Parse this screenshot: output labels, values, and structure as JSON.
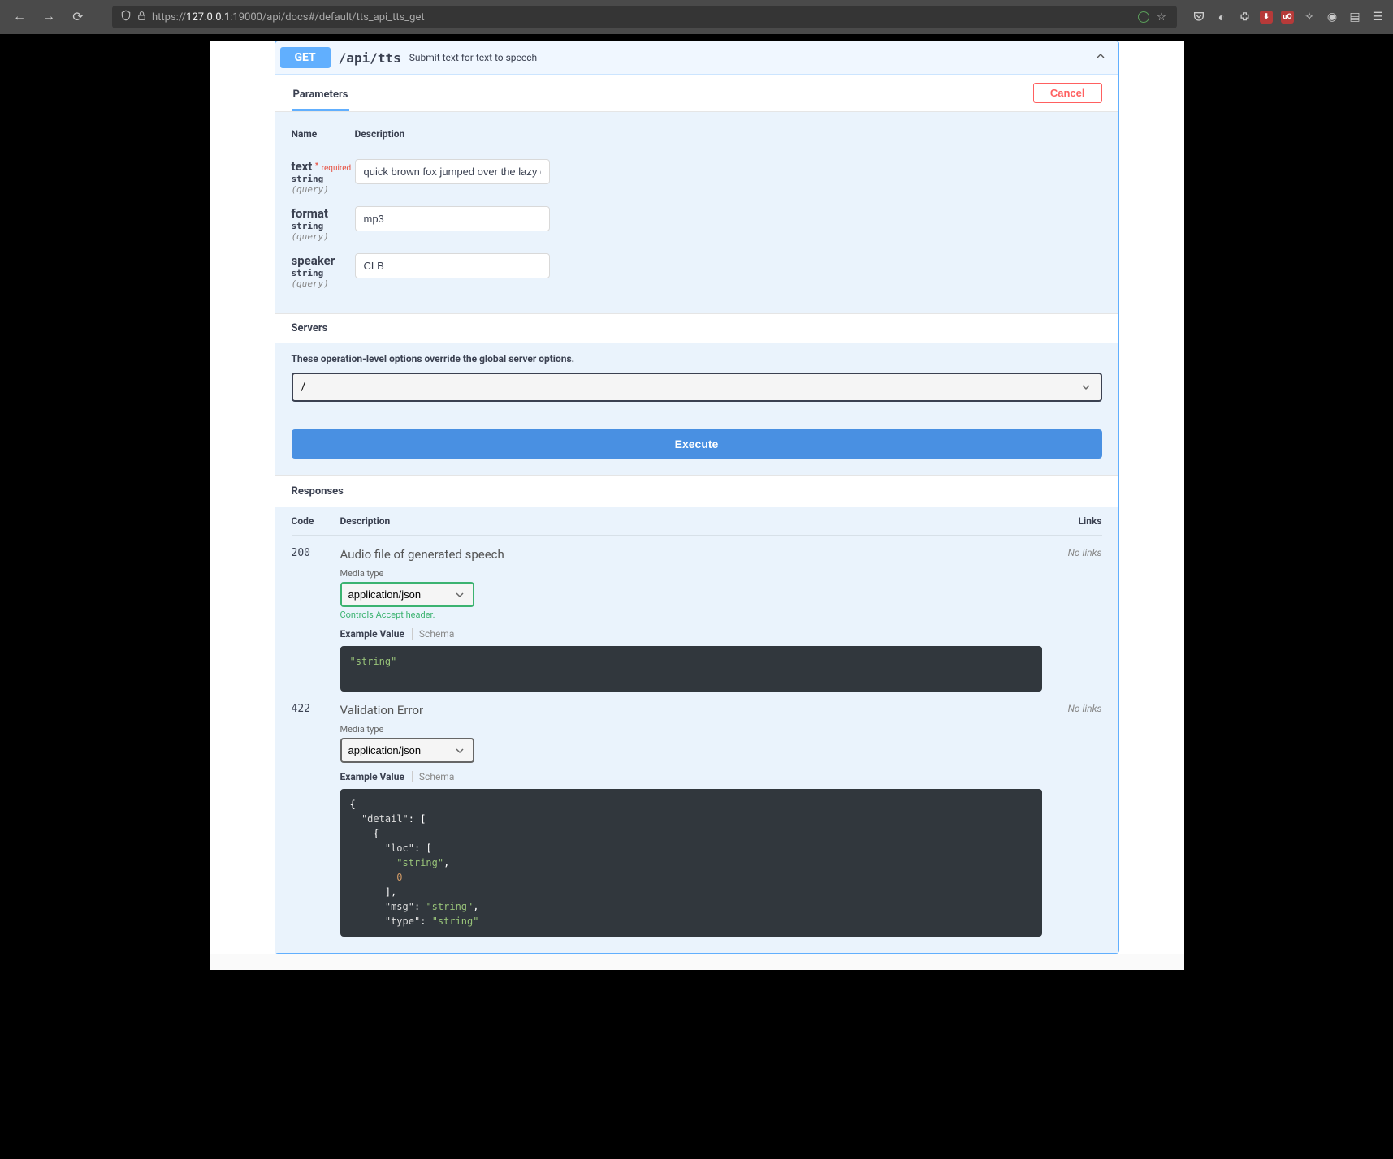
{
  "browser": {
    "url_prefix": "https://",
    "url_host_bold": "127.0.0.1",
    "url_rest": ":19000/api/docs#/default/tts_api_tts_get"
  },
  "endpoint": {
    "method": "GET",
    "path": "/api/tts",
    "summary": "Submit text for text to speech"
  },
  "parameters": {
    "section_label": "Parameters",
    "cancel_label": "Cancel",
    "head_name": "Name",
    "head_desc": "Description",
    "required_label": "required",
    "type_label": "string",
    "in_label": "(query)",
    "items": [
      {
        "name": "text",
        "required": true,
        "value": "quick brown fox jumped over the lazy dog"
      },
      {
        "name": "format",
        "required": false,
        "value": "mp3"
      },
      {
        "name": "speaker",
        "required": false,
        "value": "CLB"
      }
    ]
  },
  "servers": {
    "section_label": "Servers",
    "note": "These operation-level options override the global server options.",
    "selected": "/"
  },
  "execute_label": "Execute",
  "responses": {
    "section_label": "Responses",
    "head_code": "Code",
    "head_desc": "Description",
    "head_links": "Links",
    "media_label": "Media type",
    "accept_note": "Controls Accept header.",
    "example_tab": "Example Value",
    "schema_tab": "Schema",
    "no_links": "No links",
    "items": [
      {
        "code": "200",
        "title": "Audio file of generated speech",
        "media": "application/json",
        "accept_note_shown": true,
        "body_html": "<span class='tok-str'>\"string\"</span>"
      },
      {
        "code": "422",
        "title": "Validation Error",
        "media": "application/json",
        "accept_note_shown": false,
        "body_html": "<span class='tok-punc'>{</span>\n  <span class='tok-key'>\"detail\"</span><span class='tok-punc'>: [</span>\n    <span class='tok-punc'>{</span>\n      <span class='tok-key'>\"loc\"</span><span class='tok-punc'>: [</span>\n        <span class='tok-str'>\"string\"</span><span class='tok-punc'>,</span>\n        <span class='tok-num'>0</span>\n      <span class='tok-punc'>],</span>\n      <span class='tok-key'>\"msg\"</span><span class='tok-punc'>:</span> <span class='tok-str'>\"string\"</span><span class='tok-punc'>,</span>\n      <span class='tok-key'>\"type\"</span><span class='tok-punc'>:</span> <span class='tok-str'>\"string\"</span>"
      }
    ]
  }
}
